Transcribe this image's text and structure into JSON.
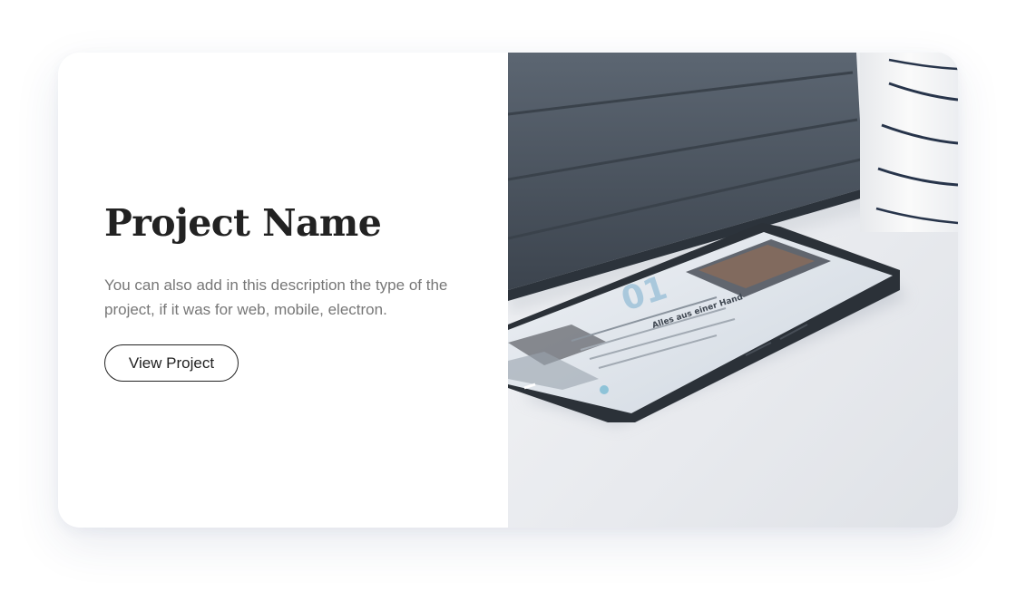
{
  "card": {
    "title": "Project Name",
    "description": "You can also add in this description the type of the project, if it was for web, mobile, electron.",
    "button_label": "View Project"
  },
  "image": {
    "subject": "smartphone-and-tablet-photo",
    "screen_number": "01",
    "screen_heading": "Alles aus einer Hand"
  },
  "colors": {
    "title": "#222222",
    "description": "#777777",
    "button_border": "#222222",
    "card_background": "#ffffff",
    "page_background": "#ffffff"
  }
}
